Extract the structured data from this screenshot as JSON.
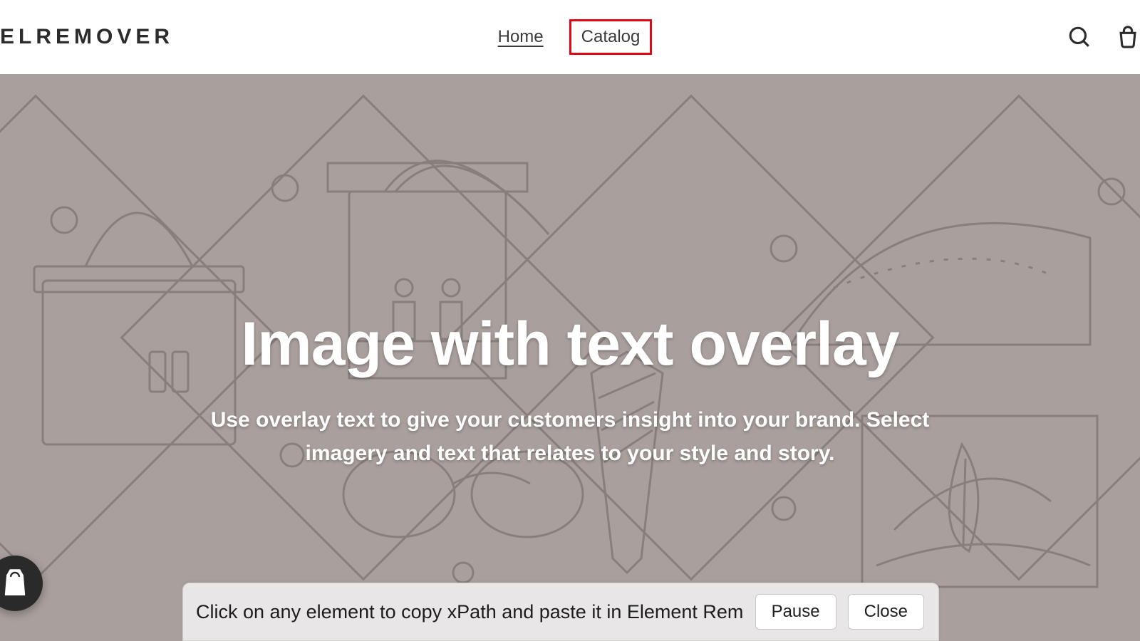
{
  "header": {
    "logo": "ELREMOVER",
    "nav": {
      "home": "Home",
      "catalog": "Catalog"
    }
  },
  "hero": {
    "title": "Image with text overlay",
    "subtitle": "Use overlay text to give your customers insight into your brand. Select imagery and text that relates to your style and story."
  },
  "toolbar": {
    "message": "Click on any element to copy xPath and paste it in Element Remover",
    "pause": "Pause",
    "close": "Close"
  },
  "icons": {
    "search": "search-icon",
    "cart": "cart-icon",
    "shopify": "shopify-bag-icon"
  },
  "colors": {
    "highlight_border": "#e30613",
    "hero_bg": "#a99f9c",
    "hero_line": "#857c79"
  }
}
